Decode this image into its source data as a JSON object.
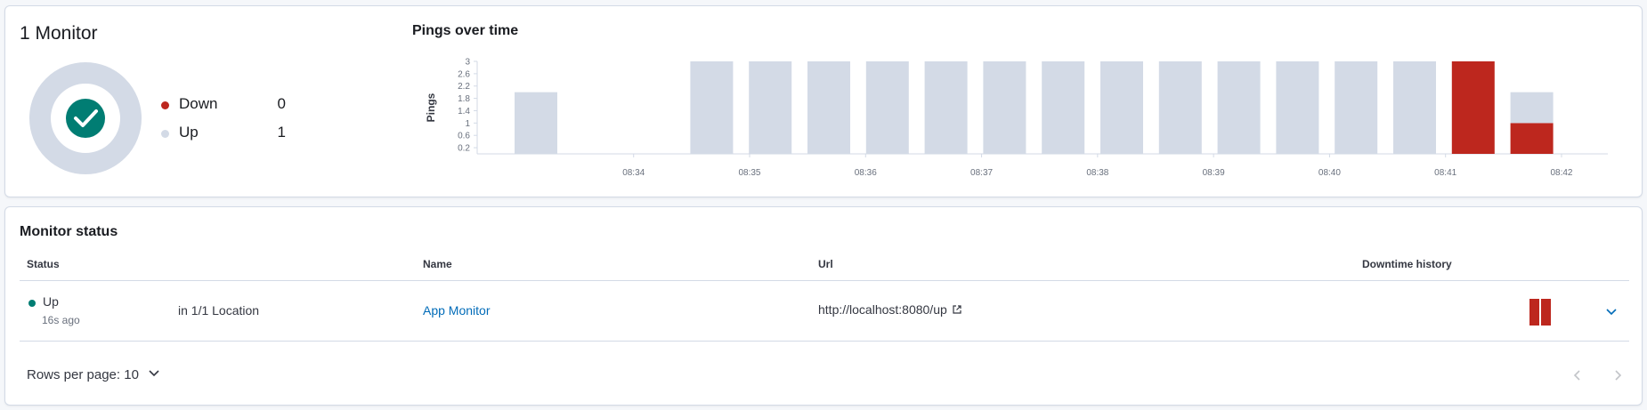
{
  "summary": {
    "title": "1 Monitor",
    "legend": [
      {
        "label": "Down",
        "value": "0",
        "color": "#bd271e"
      },
      {
        "label": "Up",
        "value": "1",
        "color": "#d3dae6"
      }
    ],
    "status_icon": "check-icon"
  },
  "chart_data": {
    "type": "bar",
    "title": "Pings over time",
    "ylabel": "Pings",
    "xlabel": "",
    "ylim": [
      0,
      3
    ],
    "y_ticks": [
      "0.2",
      "0.6",
      "1",
      "1.4",
      "1.8",
      "2.2",
      "2.6",
      "3"
    ],
    "x_ticks": [
      "08:34",
      "08:35",
      "08:36",
      "08:37",
      "08:38",
      "08:39",
      "08:40",
      "08:41",
      "08:42"
    ],
    "stacked": true,
    "series": [
      {
        "name": "Down",
        "color": "#bd271e",
        "values": [
          0,
          0,
          0,
          0,
          0,
          0,
          0,
          0,
          0,
          0,
          0,
          0,
          0,
          0,
          0,
          0,
          3,
          1
        ]
      },
      {
        "name": "Up",
        "color": "#d3dae6",
        "values": [
          2,
          0,
          0,
          3,
          3,
          3,
          3,
          3,
          3,
          3,
          3,
          3,
          3,
          3,
          3,
          3,
          0,
          1
        ]
      }
    ],
    "grid": false
  },
  "monitor_status": {
    "title": "Monitor status",
    "columns": {
      "status": "Status",
      "name": "Name",
      "url": "Url",
      "downtime": "Downtime history"
    },
    "rows": [
      {
        "status": "Up",
        "status_color": "#017d73",
        "time_ago": "16s ago",
        "location": "in 1/1 Location",
        "name": "App Monitor",
        "url": "http://localhost:8080/up"
      }
    ],
    "rows_per_page": "Rows per page: 10"
  }
}
